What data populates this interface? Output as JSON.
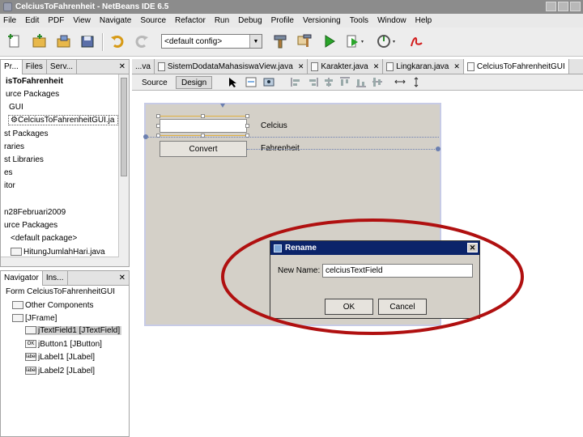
{
  "window": {
    "title": "CelciusToFahrenheit - NetBeans IDE 6.5"
  },
  "menu": [
    "File",
    "Edit",
    "PDF",
    "View",
    "Navigate",
    "Source",
    "Refactor",
    "Run",
    "Debug",
    "Profile",
    "Versioning",
    "Tools",
    "Window",
    "Help"
  ],
  "toolbar": {
    "config": "<default config>"
  },
  "projects_panel": {
    "tabs": [
      "Pr...",
      "Files",
      "Serv..."
    ],
    "items": [
      "isToFahrenheit",
      "urce Packages",
      "GUI",
      "CelciusToFahrenheitGUI.ja",
      "st Packages",
      "raries",
      "st Libraries",
      "es",
      "itor",
      "n28Februari2009",
      "urce Packages",
      "<default package>",
      "HitungJumlahHari.java"
    ]
  },
  "navigator_panel": {
    "tabs": [
      "Navigator",
      "Ins..."
    ],
    "items": [
      "Form CelciusToFahrenheitGUI",
      "Other Components",
      "[JFrame]",
      "jTextField1 [JTextField]",
      "jButton1 [JButton]",
      "jLabel1 [JLabel]",
      "jLabel2 [JLabel]"
    ],
    "icon_labels": [
      "OK",
      "label",
      "label"
    ]
  },
  "editor_tabs": [
    "...va",
    "SistemDodataMahasiswaView.java",
    "Karakter.java",
    "Lingkaran.java",
    "CelciusToFahrenheitGUI"
  ],
  "design_bar": {
    "source": "Source",
    "design": "Design"
  },
  "form": {
    "button_label": "Convert",
    "label1": "Celcius",
    "label2": "Fahrenheit"
  },
  "dialog": {
    "title": "Rename",
    "label": "New Name:",
    "value": "celciusTextField",
    "ok": "OK",
    "cancel": "Cancel"
  },
  "annotation_color": "#b01010"
}
